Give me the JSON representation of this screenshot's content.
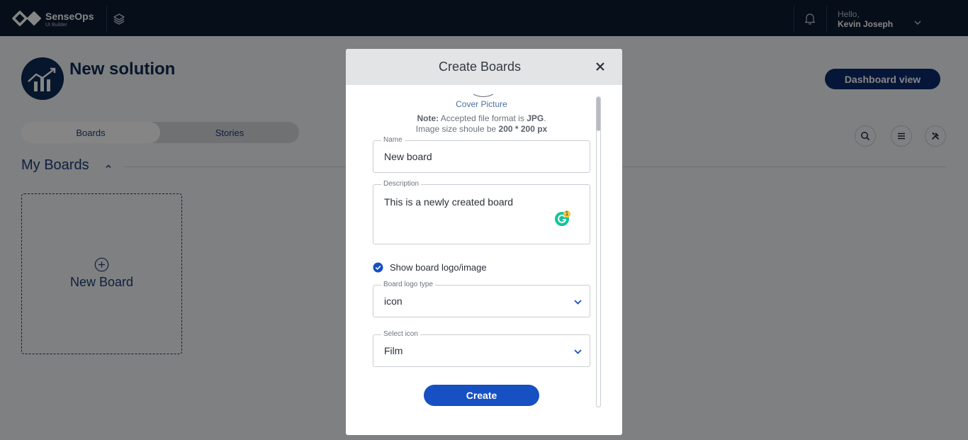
{
  "app": {
    "brand": "SenseOps",
    "brand_sub": "UI Builder",
    "greeting": "Hello,",
    "user_name": "Kevin Joseph"
  },
  "page": {
    "title": "New solution",
    "dashboard_button": "Dashboard view",
    "tabs": [
      {
        "label": "Boards",
        "active": true
      },
      {
        "label": "Stories",
        "active": false
      }
    ],
    "section_title": "My Boards",
    "new_board_label": "New Board"
  },
  "modal": {
    "title": "Create Boards",
    "cover_label": "Cover Picture",
    "note_prefix": "Note:",
    "note_text": " Accepted file format is ",
    "note_format": "JPG",
    "note_end": ".",
    "size_text": "Image size shoule be ",
    "size_value": "200 * 200 px",
    "name_label": "Name",
    "name_value": "New board",
    "description_label": "Description",
    "description_value": "This is a newly created board",
    "grammarly_count": "1",
    "show_logo_label": "Show board logo/image",
    "show_logo_checked": true,
    "logo_type_label": "Board logo type",
    "logo_type_value": "icon",
    "select_icon_label": "Select icon",
    "select_icon_value": "Film",
    "create_button": "Create"
  },
  "colors": {
    "topbar": "#0c1c33",
    "primary": "#1650c2",
    "navy": "#0c2b55",
    "grammarly": "#15c39a"
  }
}
